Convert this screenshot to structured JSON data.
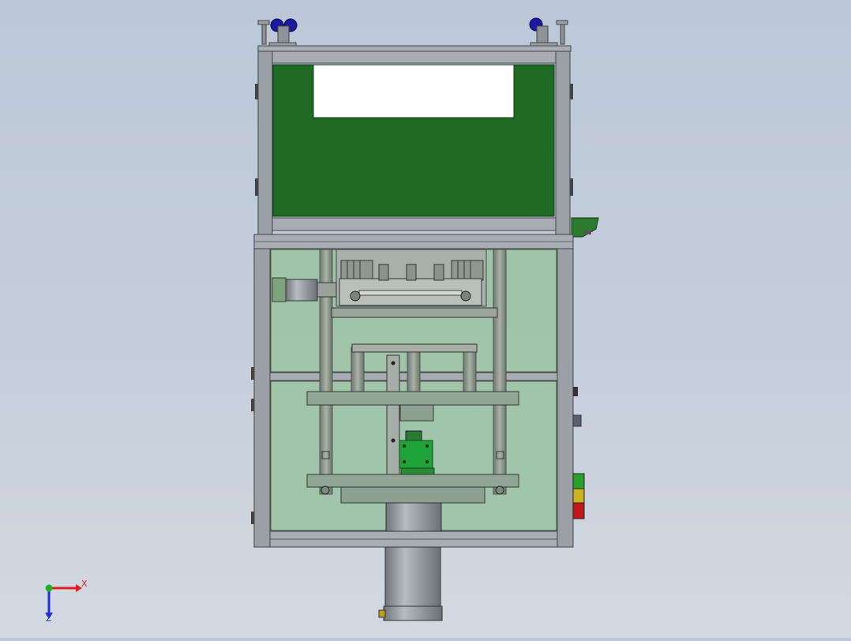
{
  "window": {
    "title": "",
    "background": "#c4cdd9"
  },
  "model": {
    "colors": {
      "frame": "#9aa0a6",
      "frame_dark": "#5a6066",
      "green_panel": "#1f6a24",
      "glass": "#9cc3a4",
      "cylinder": "#8f9599",
      "motor_green": "#1fa33a",
      "caster_wheel": "#1a1aa0",
      "light_green": "#2aa02a",
      "light_yellow": "#c8b420",
      "light_red": "#c01818"
    }
  },
  "triad": {
    "x_label": "X",
    "y_label": "",
    "z_label": "Z",
    "x_color": "#e02020",
    "y_color": "#20b020",
    "z_color": "#2030d0"
  }
}
